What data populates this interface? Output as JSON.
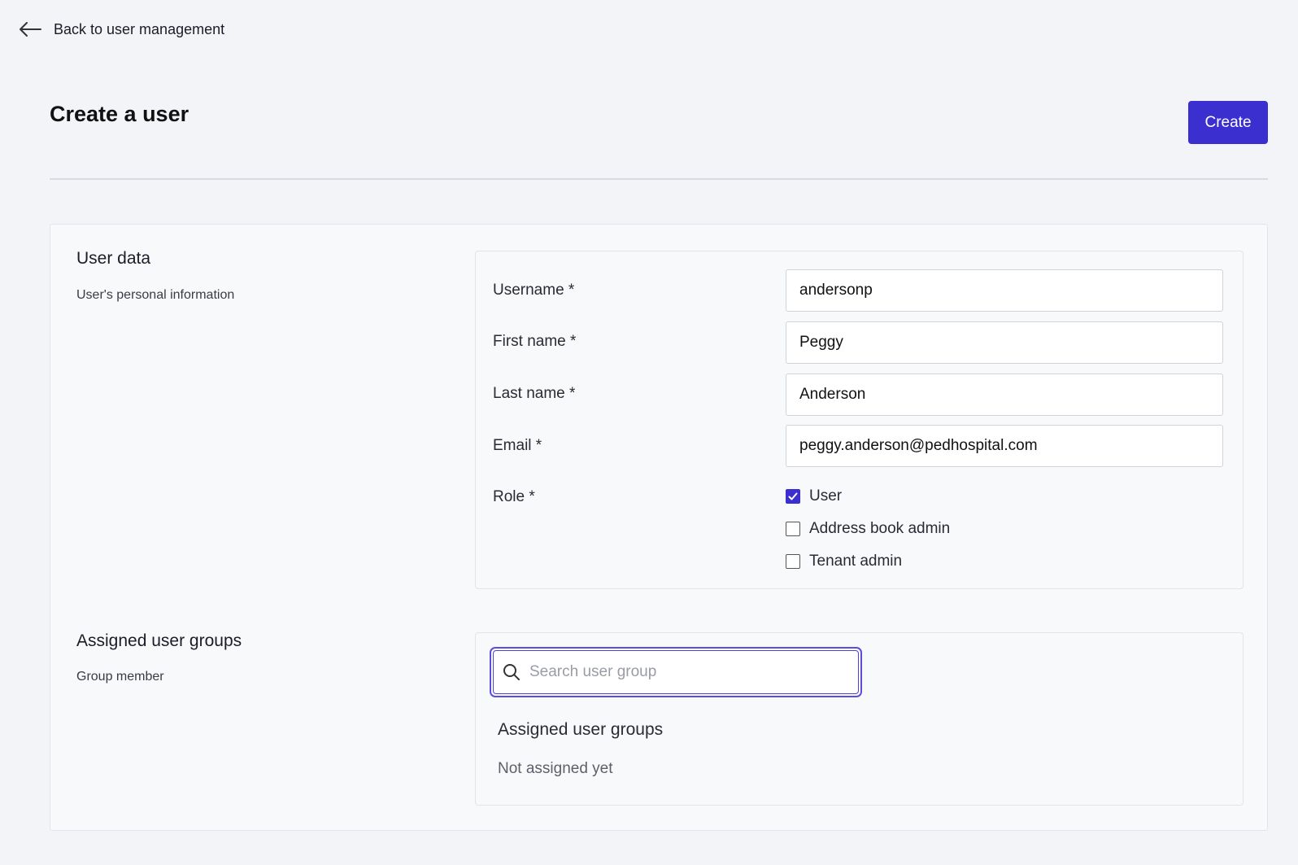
{
  "nav": {
    "back_label": "Back to user management"
  },
  "header": {
    "title": "Create a user",
    "create_label": "Create"
  },
  "user_data": {
    "title": "User data",
    "subtitle": "User's personal information",
    "fields": {
      "username": {
        "label": "Username *",
        "value": "andersonp"
      },
      "first_name": {
        "label": "First name *",
        "value": "Peggy"
      },
      "last_name": {
        "label": "Last name *",
        "value": "Anderson"
      },
      "email": {
        "label": "Email *",
        "value": "peggy.anderson@pedhospital.com"
      }
    },
    "role": {
      "label": "Role *",
      "options": [
        {
          "label": "User",
          "checked": true
        },
        {
          "label": "Address book admin",
          "checked": false
        },
        {
          "label": "Tenant admin",
          "checked": false
        }
      ]
    }
  },
  "groups": {
    "title": "Assigned user groups",
    "subtitle": "Group member",
    "search_placeholder": "Search user group",
    "list_heading": "Assigned user groups",
    "empty_text": "Not assigned yet"
  },
  "colors": {
    "accent": "#3b2fd0",
    "background": "#f2f4f8"
  }
}
